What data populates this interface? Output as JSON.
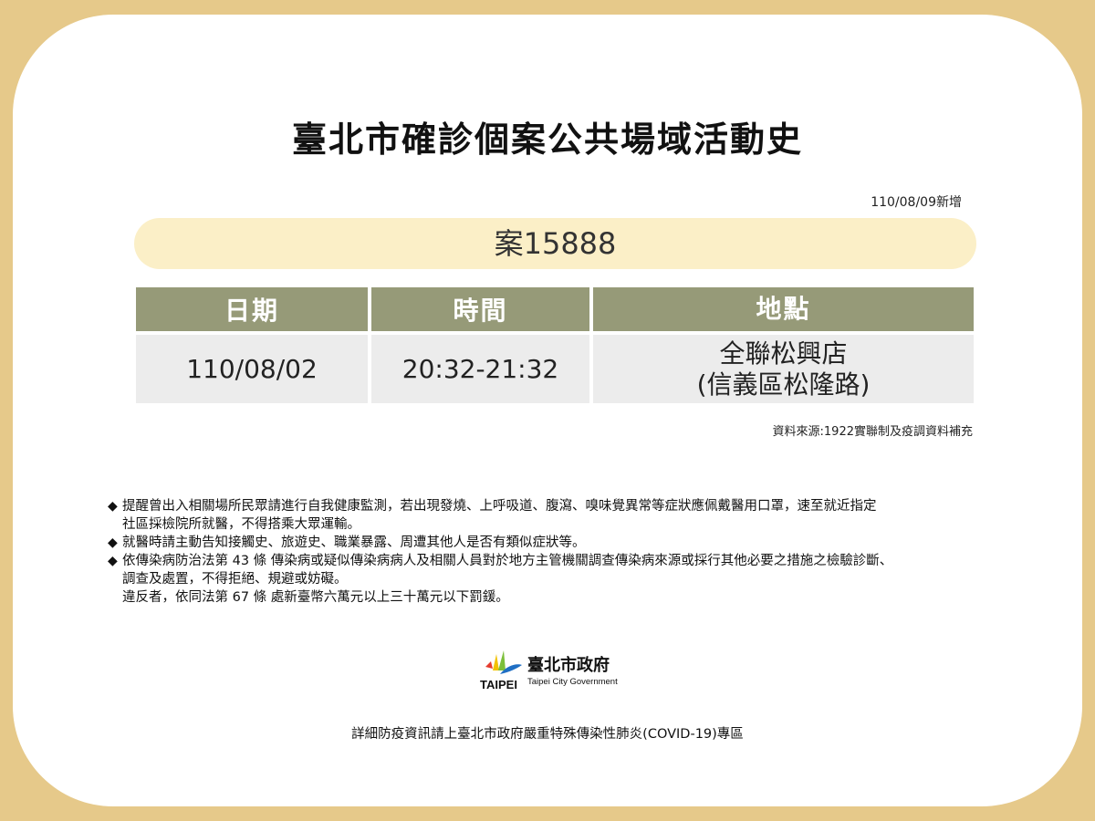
{
  "title": "臺北市確診個案公共場域活動史",
  "update_date": "110/08/09新增",
  "case_label": "案15888",
  "table": {
    "headers": [
      "日期",
      "時間",
      "地點"
    ],
    "rows": [
      {
        "date": "110/08/02",
        "time": "20:32-21:32",
        "place_line1": "全聯松興店",
        "place_line2": "(信義區松隆路)"
      }
    ]
  },
  "source_note": "資料來源:1922實聯制及疫調資料補充",
  "bullet_symbol": "◆",
  "notes": [
    {
      "lines": [
        "提醒曾出入相關場所民眾請進行自我健康監測，若出現發燒、上呼吸道、腹瀉、嗅味覺異常等症狀應佩戴醫用口罩，速至就近指定",
        "社區採檢院所就醫，不得搭乘大眾運輸。"
      ]
    },
    {
      "lines": [
        "就醫時請主動告知接觸史、旅遊史、職業暴露、周遭其他人是否有類似症狀等。"
      ]
    },
    {
      "lines": [
        "依傳染病防治法第 43 條 傳染病或疑似傳染病病人及相關人員對於地方主管機關調查傳染病來源或採行其他必要之措施之檢驗診斷、",
        "調查及處置，不得拒絕、規避或妨礙。",
        "違反者，依同法第 67 條 處新臺幣六萬元以上三十萬元以下罰鍰。"
      ]
    }
  ],
  "logo": {
    "text_en": "TAIPEI",
    "text_zh": "臺北市政府",
    "text_sub": "Taipei City Government"
  },
  "footer": "詳細防疫資訊請上臺北市政府嚴重特殊傳染性肺炎(COVID-19)專區",
  "colors": {
    "background": "#e6c98a",
    "card": "#ffffff",
    "pill": "#fbefc7",
    "table_header": "#969a78",
    "table_cell": "#ececec"
  }
}
